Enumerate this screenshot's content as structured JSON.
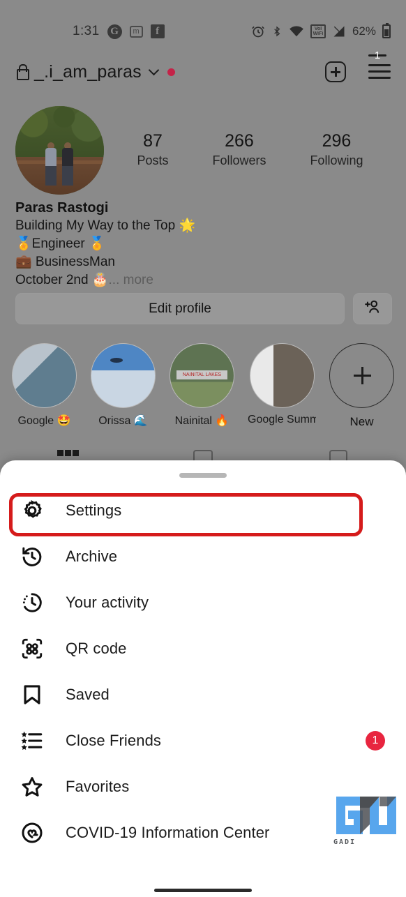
{
  "status_bar": {
    "time": "1:31",
    "left_icons": [
      "google-icon",
      "m-icon",
      "facebook-icon"
    ],
    "right_icons": [
      "alarm-icon",
      "bluetooth-icon",
      "wifi-icon",
      "vowifi-icon",
      "signal-icon"
    ],
    "vowifi_top": "VoI",
    "vowifi_bottom": "WiFi",
    "battery_percent": "62%"
  },
  "header": {
    "username": "_.i_am_paras",
    "lock_icon": "lock-icon",
    "chevron_icon": "chevron-down-icon",
    "status_dot": "red-dot",
    "create_icon": "plus-box-icon",
    "menu_icon": "hamburger-icon",
    "menu_badge": "1"
  },
  "profile": {
    "avatar_alt": "profile-photo",
    "stats": [
      {
        "value": "87",
        "label": "Posts"
      },
      {
        "value": "266",
        "label": "Followers"
      },
      {
        "value": "296",
        "label": "Following"
      }
    ],
    "name": "Paras Rastogi",
    "bio_lines": [
      "Building My Way to the Top 🌟",
      "🏅Engineer 🏅",
      "💼 BusinessMan"
    ],
    "birthday": "October 2nd 🎂",
    "more_label": "... more",
    "edit_profile_label": "Edit profile",
    "add_person_icon": "add-person-icon"
  },
  "highlights": [
    {
      "label": "Google 🤩"
    },
    {
      "label": "Orissa 🌊"
    },
    {
      "label": "Nainital 🔥"
    },
    {
      "label": "Google Summi…"
    }
  ],
  "highlight_new": {
    "label": "New",
    "icon": "plus-circle-icon"
  },
  "tabs": [
    {
      "name": "grid-tab",
      "icon": "grid-icon"
    },
    {
      "name": "reels-tab",
      "icon": "reels-icon"
    },
    {
      "name": "tagged-tab",
      "icon": "tagged-icon"
    }
  ],
  "sheet": {
    "drag_handle": "drag-handle",
    "highlighted_item": "Settings",
    "highlight_color": "#d51b1b",
    "items": [
      {
        "label": "Settings",
        "icon": "gear-icon",
        "badge": null
      },
      {
        "label": "Archive",
        "icon": "archive-clock-icon",
        "badge": null
      },
      {
        "label": "Your activity",
        "icon": "activity-clock-icon",
        "badge": null
      },
      {
        "label": "QR code",
        "icon": "qr-code-icon",
        "badge": null
      },
      {
        "label": "Saved",
        "icon": "bookmark-icon",
        "badge": null
      },
      {
        "label": "Close Friends",
        "icon": "close-friends-list-icon",
        "badge": "1"
      },
      {
        "label": "Favorites",
        "icon": "star-icon",
        "badge": null
      },
      {
        "label": "COVID-19 Information Center",
        "icon": "covid-heart-icon",
        "badge": null
      }
    ]
  },
  "watermark": {
    "text": "GADI",
    "logo": "gu-logo",
    "color": "#58a6ed"
  }
}
